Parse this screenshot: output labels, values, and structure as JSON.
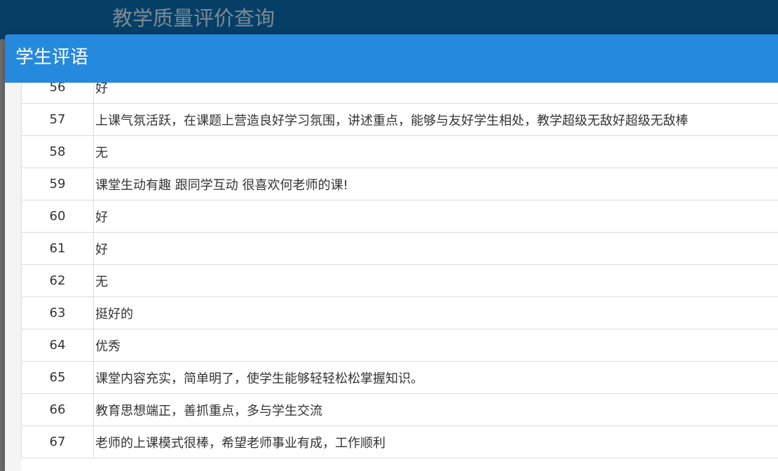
{
  "header": {
    "title": "教学质量评价查询"
  },
  "modal": {
    "title": "学生评语"
  },
  "rows": [
    {
      "index": "56",
      "comment": "好"
    },
    {
      "index": "57",
      "comment": "上课气氛活跃，在课题上营造良好学习氛围，讲述重点，能够与友好学生相处，教学超级无敌好超级无敌棒"
    },
    {
      "index": "58",
      "comment": "无"
    },
    {
      "index": "59",
      "comment": "课堂生动有趣 跟同学互动 很喜欢何老师的课!"
    },
    {
      "index": "60",
      "comment": "好"
    },
    {
      "index": "61",
      "comment": "好"
    },
    {
      "index": "62",
      "comment": "无"
    },
    {
      "index": "63",
      "comment": "挺好的"
    },
    {
      "index": "64",
      "comment": "优秀"
    },
    {
      "index": "65",
      "comment": "课堂内容充实，简单明了，使学生能够轻轻松松掌握知识。"
    },
    {
      "index": "66",
      "comment": "教育思想端正，善抓重点，多与学生交流"
    },
    {
      "index": "67",
      "comment": "老师的上课模式很棒，希望老师事业有成，工作顺利"
    }
  ]
}
